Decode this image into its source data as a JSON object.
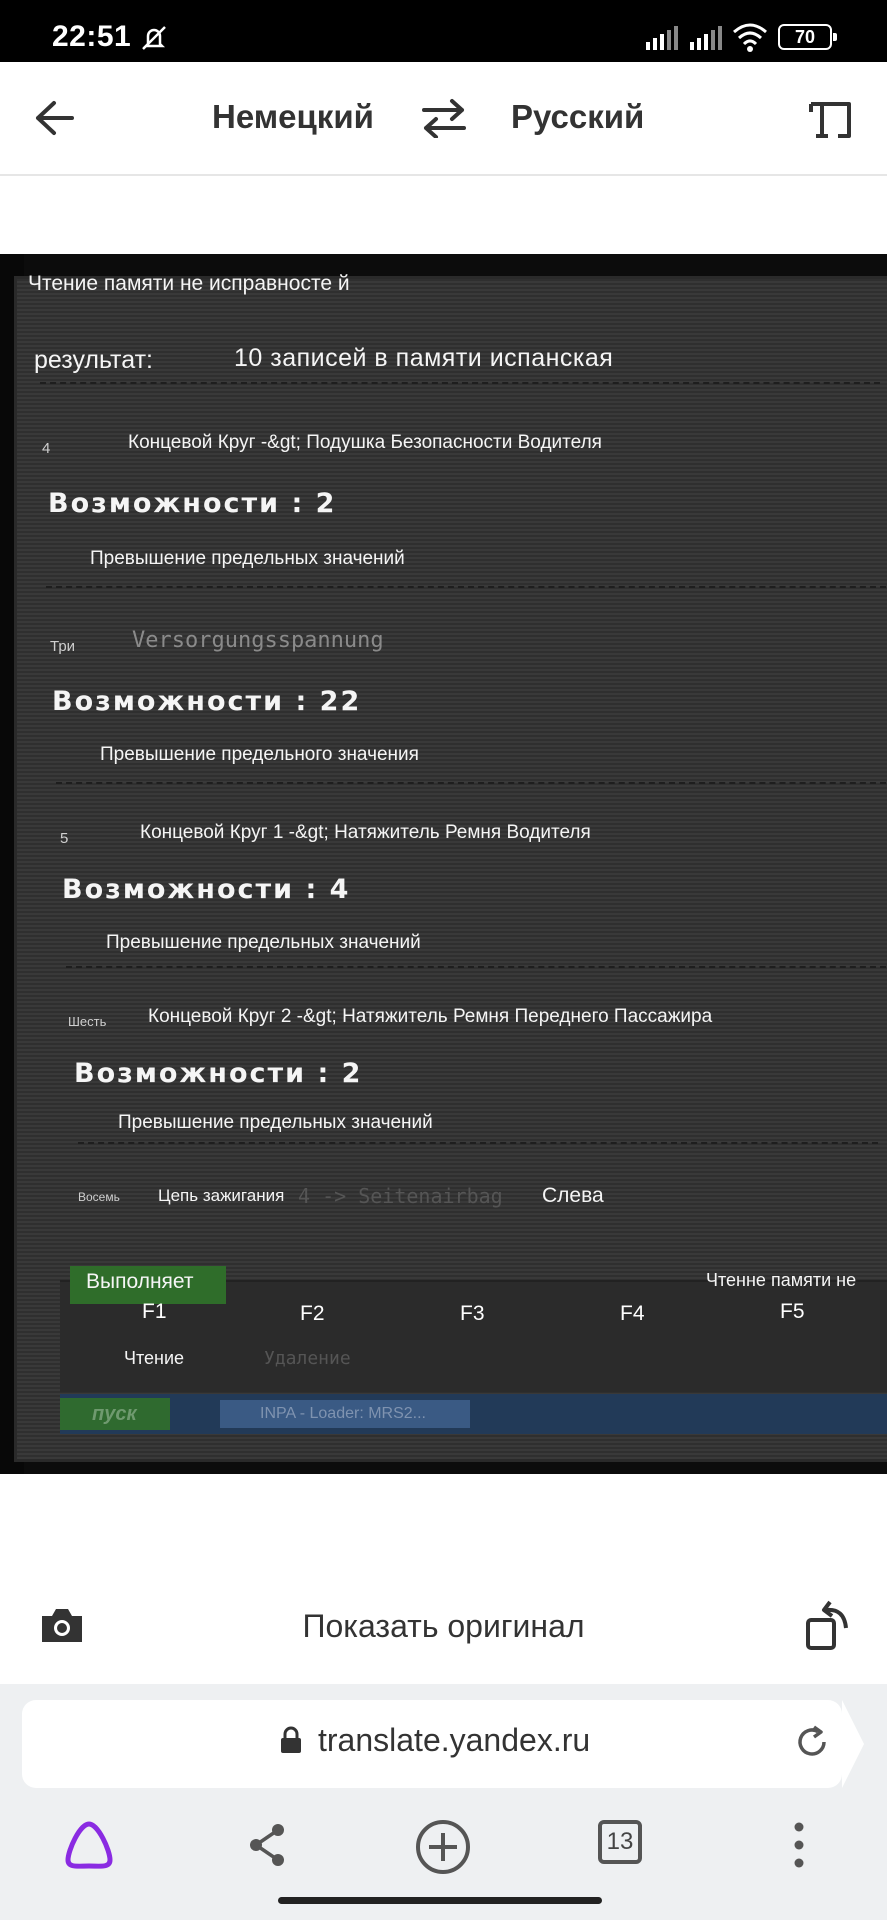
{
  "status_bar": {
    "time": "22:51",
    "battery": "70"
  },
  "header": {
    "source_lang": "Немецкий",
    "target_lang": "Русский"
  },
  "photo": {
    "window_title": "Чтение памяти не исправносте й",
    "result_label": "результат:",
    "result_value": "10 записей в памяти испанская",
    "records": [
      {
        "number": "4",
        "title": "Концевой Круг -&gt; Подушка Безопасности Водителя",
        "capability": "Возможности : 2",
        "description": "Превышение предельных значений"
      },
      {
        "number": "Три",
        "title": "Versorgungsspannung",
        "capability": "Возможности : 22",
        "description": "Превышение предельного значения"
      },
      {
        "number": "5",
        "title": "Концевой Круг 1 -&gt; Натяжитель Ремня Водителя",
        "capability": "Возможности : 4",
        "description": "Превышение предельных значений"
      },
      {
        "number": "Шесть",
        "title": "Концевой Круг 2 -&gt; Натяжитель Ремня Переднего Пассажира",
        "capability": "Возможности : 2",
        "description": "Превышение предельных значений"
      }
    ],
    "last_record": {
      "number": "Восемь",
      "title": "Цепь зажигания",
      "ghost": "4 -> Seitenairbag",
      "side": "Слева"
    },
    "execute_label": "Выполняет",
    "right_status": "Чтенне памяти не",
    "fkeys": [
      "F1",
      "F2",
      "F3",
      "F4",
      "F5"
    ],
    "f1_sub": "Чтение",
    "f2_sub": "Удаление",
    "start_label": "пуск",
    "task_label": "INPA - Loader: MRS2..."
  },
  "actions": {
    "show_original": "Показать оригинал"
  },
  "browser": {
    "url": "translate.yandex.ru",
    "tabs_count": "13"
  },
  "colors": {
    "alice_purple": "#8a2be2",
    "task_green": "#2f6d2a"
  }
}
